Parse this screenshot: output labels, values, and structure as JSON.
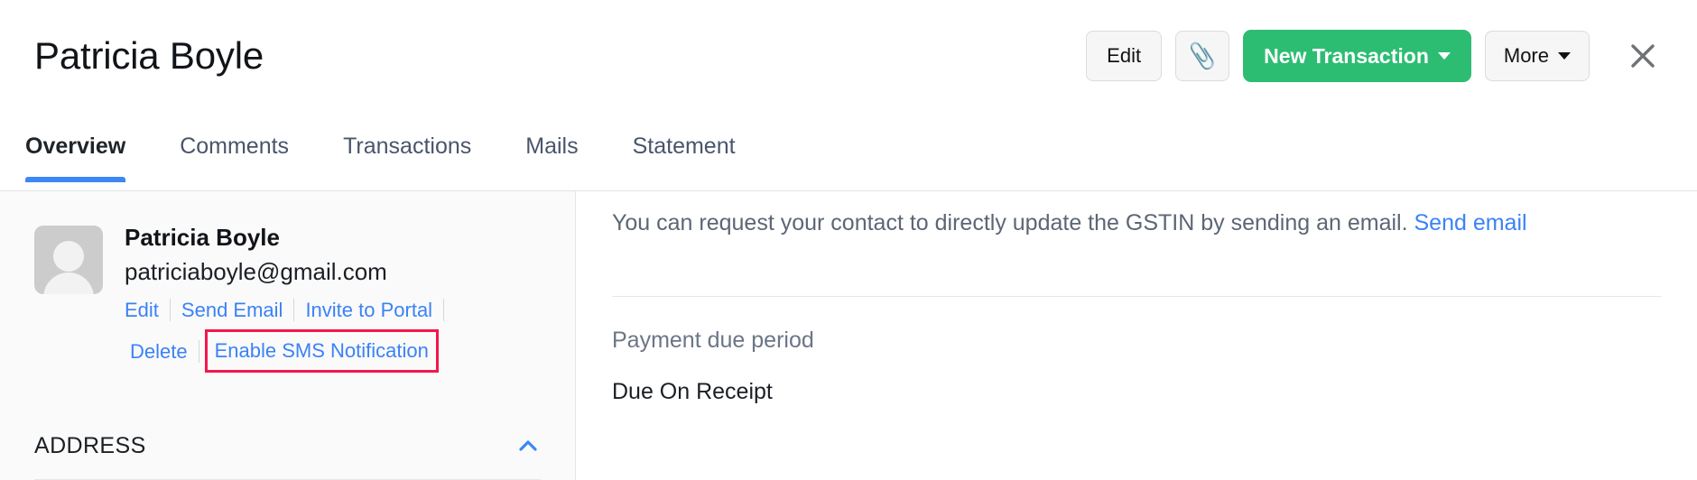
{
  "header": {
    "title": "Patricia Boyle",
    "actions": {
      "edit_label": "Edit",
      "attachment_icon": "paperclip-icon",
      "new_transaction_label": "New Transaction",
      "more_label": "More",
      "close_icon": "close-icon"
    }
  },
  "tabs": [
    {
      "label": "Overview",
      "active": true
    },
    {
      "label": "Comments",
      "active": false
    },
    {
      "label": "Transactions",
      "active": false
    },
    {
      "label": "Mails",
      "active": false
    },
    {
      "label": "Statement",
      "active": false
    }
  ],
  "sidebar": {
    "avatar_icon": "user-avatar-placeholder-icon",
    "contact_name": "Patricia Boyle",
    "contact_email": "patriciaboyle@gmail.com",
    "links_row_1": [
      "Edit",
      "Send Email",
      "Invite to Portal"
    ],
    "links_row_2": [
      "Delete",
      "Enable SMS Notification"
    ],
    "highlighted_link": "Enable SMS Notification",
    "highlight_color": "#f2174f",
    "address": {
      "label": "ADDRESS",
      "collapse_icon": "chevron-up-icon"
    }
  },
  "main": {
    "gstin_note_text": "You can request your contact to directly update the GSTIN by sending an email.",
    "gstin_note_link": "Send email",
    "payment_due_label": "Payment due period",
    "payment_due_value": "Due On Receipt"
  },
  "colors": {
    "primary_green": "#2dbd72",
    "link_blue": "#3b82f6",
    "active_tab_blue": "#3d87f5",
    "highlight_pink": "#f2174f"
  }
}
